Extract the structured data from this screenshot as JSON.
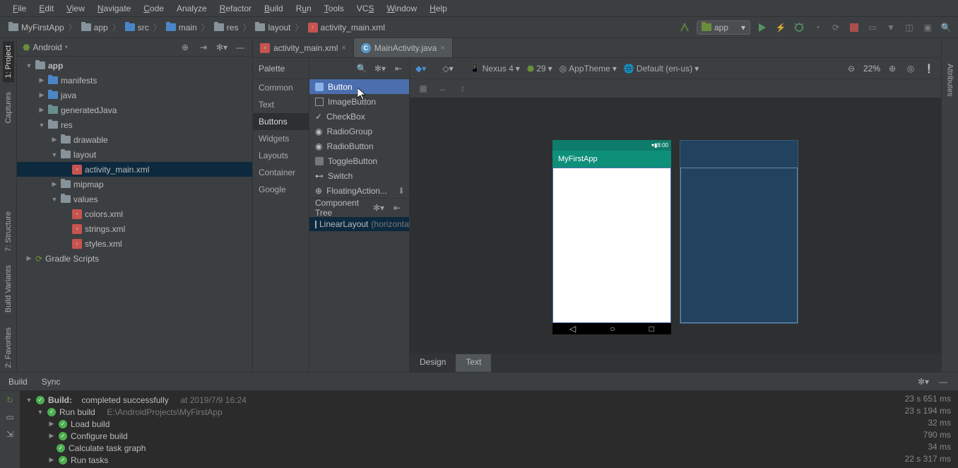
{
  "menu": [
    "File",
    "Edit",
    "View",
    "Navigate",
    "Code",
    "Analyze",
    "Refactor",
    "Build",
    "Run",
    "Tools",
    "VCS",
    "Window",
    "Help"
  ],
  "breadcrumb": {
    "project": "MyFirstApp",
    "module": "app",
    "src": "src",
    "main": "main",
    "res": "res",
    "layout": "layout",
    "file": "activity_main.xml"
  },
  "runConfig": "app",
  "projectPanel": {
    "title": "Android",
    "app": "app",
    "manifests": "manifests",
    "java": "java",
    "generatedJava": "generatedJava",
    "res": "res",
    "drawable": "drawable",
    "layout": "layout",
    "activityMain": "activity_main.xml",
    "mipmap": "mipmap",
    "values": "values",
    "colors": "colors.xml",
    "strings": "strings.xml",
    "styles": "styles.xml",
    "gradle": "Gradle Scripts"
  },
  "tabs": {
    "t1": "activity_main.xml",
    "t2": "MainActivity.java"
  },
  "palette": {
    "title": "Palette",
    "cats": [
      "Common",
      "Text",
      "Buttons",
      "Widgets",
      "Layouts",
      "Container",
      "Google"
    ],
    "selected": "Buttons",
    "widgets": [
      "Button",
      "ImageButton",
      "CheckBox",
      "RadioGroup",
      "RadioButton",
      "ToggleButton",
      "Switch",
      "FloatingAction..."
    ]
  },
  "canvasToolbar": {
    "device": "Nexus 4",
    "api": "29",
    "theme": "AppTheme",
    "locale": "Default (en-us)",
    "zoom": "22%"
  },
  "phone": {
    "title": "MyFirstApp"
  },
  "componentTree": {
    "title": "Component Tree",
    "root": "LinearLayout",
    "orient": "(horizontal)"
  },
  "designTabs": {
    "design": "Design",
    "text": "Text"
  },
  "bottomBar": {
    "build": "Build",
    "sync": "Sync"
  },
  "buildPanel": {
    "b1l": "Build:",
    "b1": "completed successfully",
    "b1d": "at 2019/7/9 16:24",
    "b2": "Run build",
    "b2d": "E:\\AndroidProjects\\MyFirstApp",
    "b3": "Load build",
    "b4": "Configure build",
    "b5": "Calculate task graph",
    "b6": "Run tasks",
    "t1": "23 s 651 ms",
    "t2": "23 s 194 ms",
    "t3": "32 ms",
    "t4": "790 ms",
    "t5": "34 ms",
    "t6": "22 s 317 ms"
  },
  "rails": {
    "project": "1: Project",
    "captures": "Captures",
    "structure": "7: Structure",
    "buildVar": "Build Variants",
    "favorites": "2: Favorites",
    "attributes": "Attributes"
  }
}
